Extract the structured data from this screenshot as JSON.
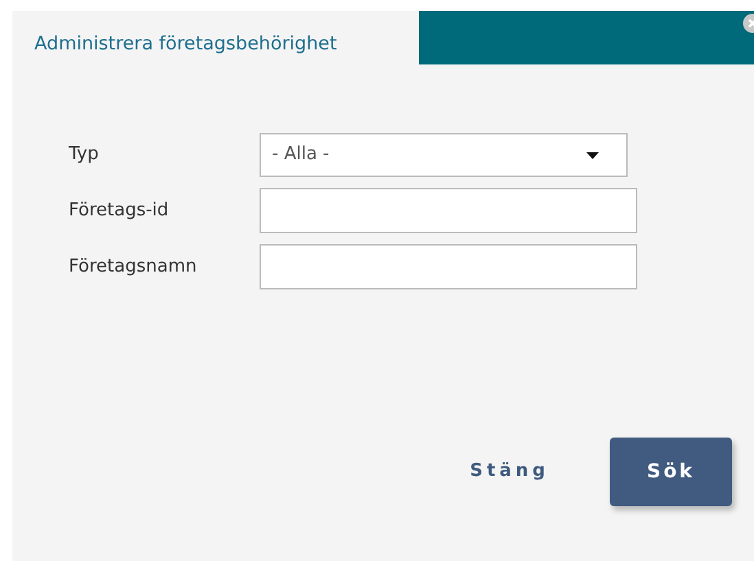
{
  "dialog": {
    "title": "Administrera företagsbehörighet"
  },
  "fields": [
    {
      "kind": "select",
      "label": "Typ",
      "value": "- Alla -"
    },
    {
      "kind": "text",
      "label": "Företags-id"
    },
    {
      "kind": "text",
      "label": "Företagsnamn"
    }
  ],
  "buttons": [
    {
      "kind": "link",
      "label": "Stäng"
    },
    {
      "kind": "primary",
      "label": "Sök"
    }
  ]
}
